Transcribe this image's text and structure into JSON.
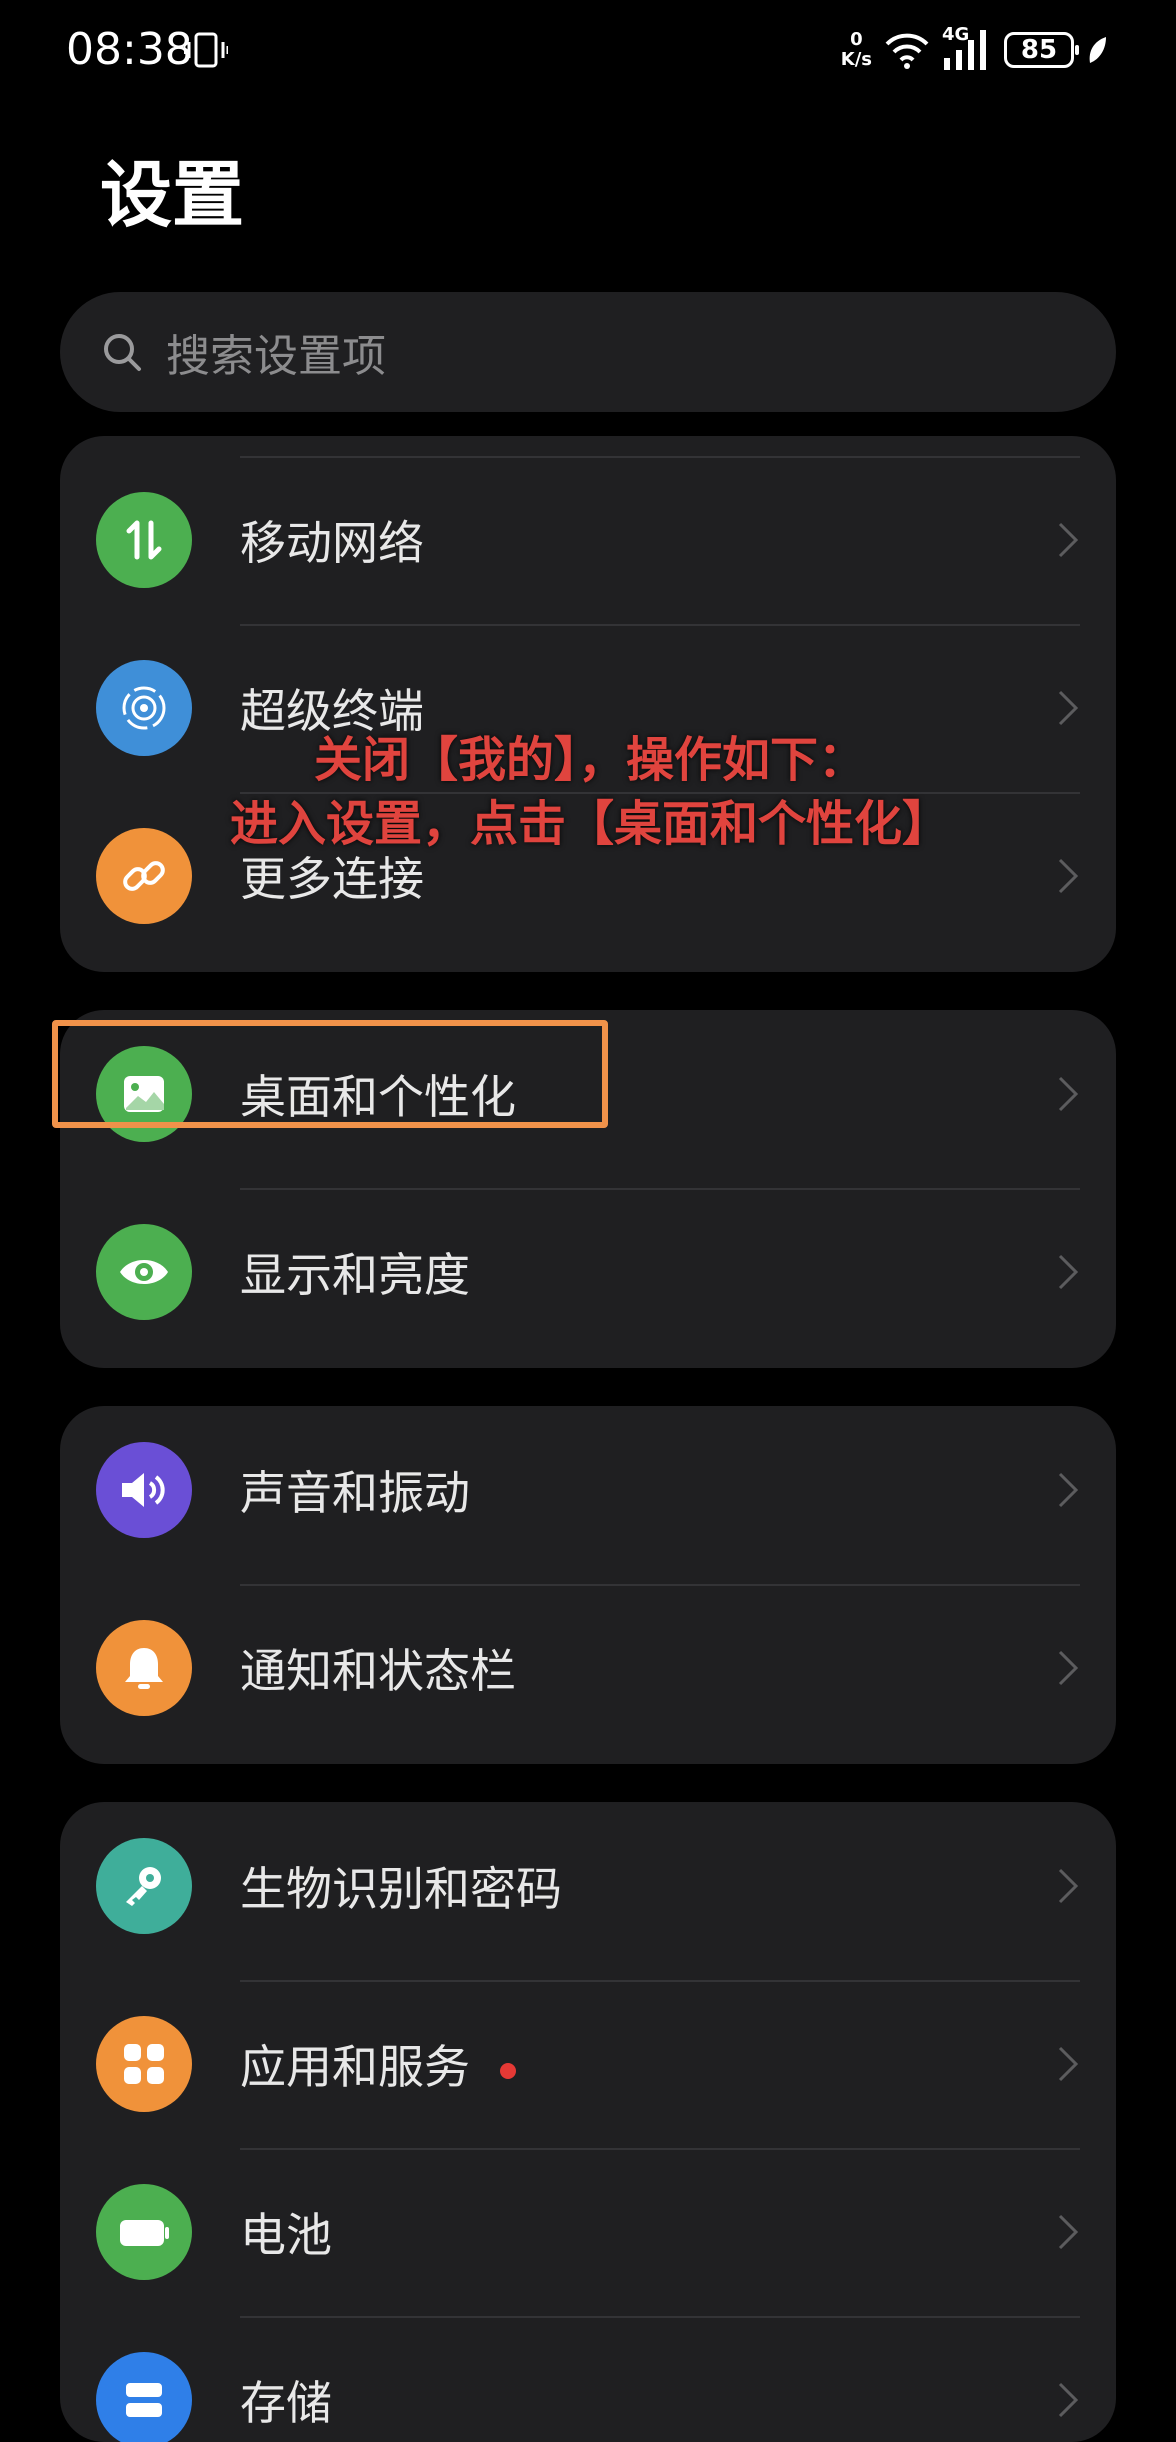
{
  "status_bar": {
    "time": "08:38",
    "net_speed_value": "0",
    "net_speed_unit": "K/s",
    "network_type": "4G",
    "battery": "85"
  },
  "page": {
    "title": "设置"
  },
  "search": {
    "placeholder": "搜索设置项"
  },
  "groups": [
    {
      "items": [
        {
          "label": "移动网络",
          "icon": "mobile-data-icon",
          "color": "#4caf50"
        },
        {
          "label": "超级终端",
          "icon": "super-device-icon",
          "color": "#3f8fd8"
        },
        {
          "label": "更多连接",
          "icon": "link-icon",
          "color": "#f0923a"
        }
      ]
    },
    {
      "items": [
        {
          "label": "桌面和个性化",
          "icon": "image-icon",
          "color": "#4caf50"
        },
        {
          "label": "显示和亮度",
          "icon": "eye-icon",
          "color": "#4caf50"
        }
      ]
    },
    {
      "items": [
        {
          "label": "声音和振动",
          "icon": "speaker-icon",
          "color": "#6a4fd6"
        },
        {
          "label": "通知和状态栏",
          "icon": "bell-icon",
          "color": "#f0923a"
        }
      ]
    },
    {
      "items": [
        {
          "label": "生物识别和密码",
          "icon": "key-icon",
          "color": "#3fae9a"
        },
        {
          "label": "应用和服务",
          "icon": "apps-icon",
          "color": "#f0923a",
          "badge": true
        },
        {
          "label": "电池",
          "icon": "battery-icon",
          "color": "#4caf50"
        },
        {
          "label": "存储",
          "icon": "storage-icon",
          "color": "#2f7fe8"
        }
      ]
    }
  ],
  "annotation": {
    "line1": "关闭【我的】，操作如下：",
    "line2": "进入设置，点击【桌面和个性化】",
    "color": "#e0443e",
    "box_color": "#f0924a"
  }
}
